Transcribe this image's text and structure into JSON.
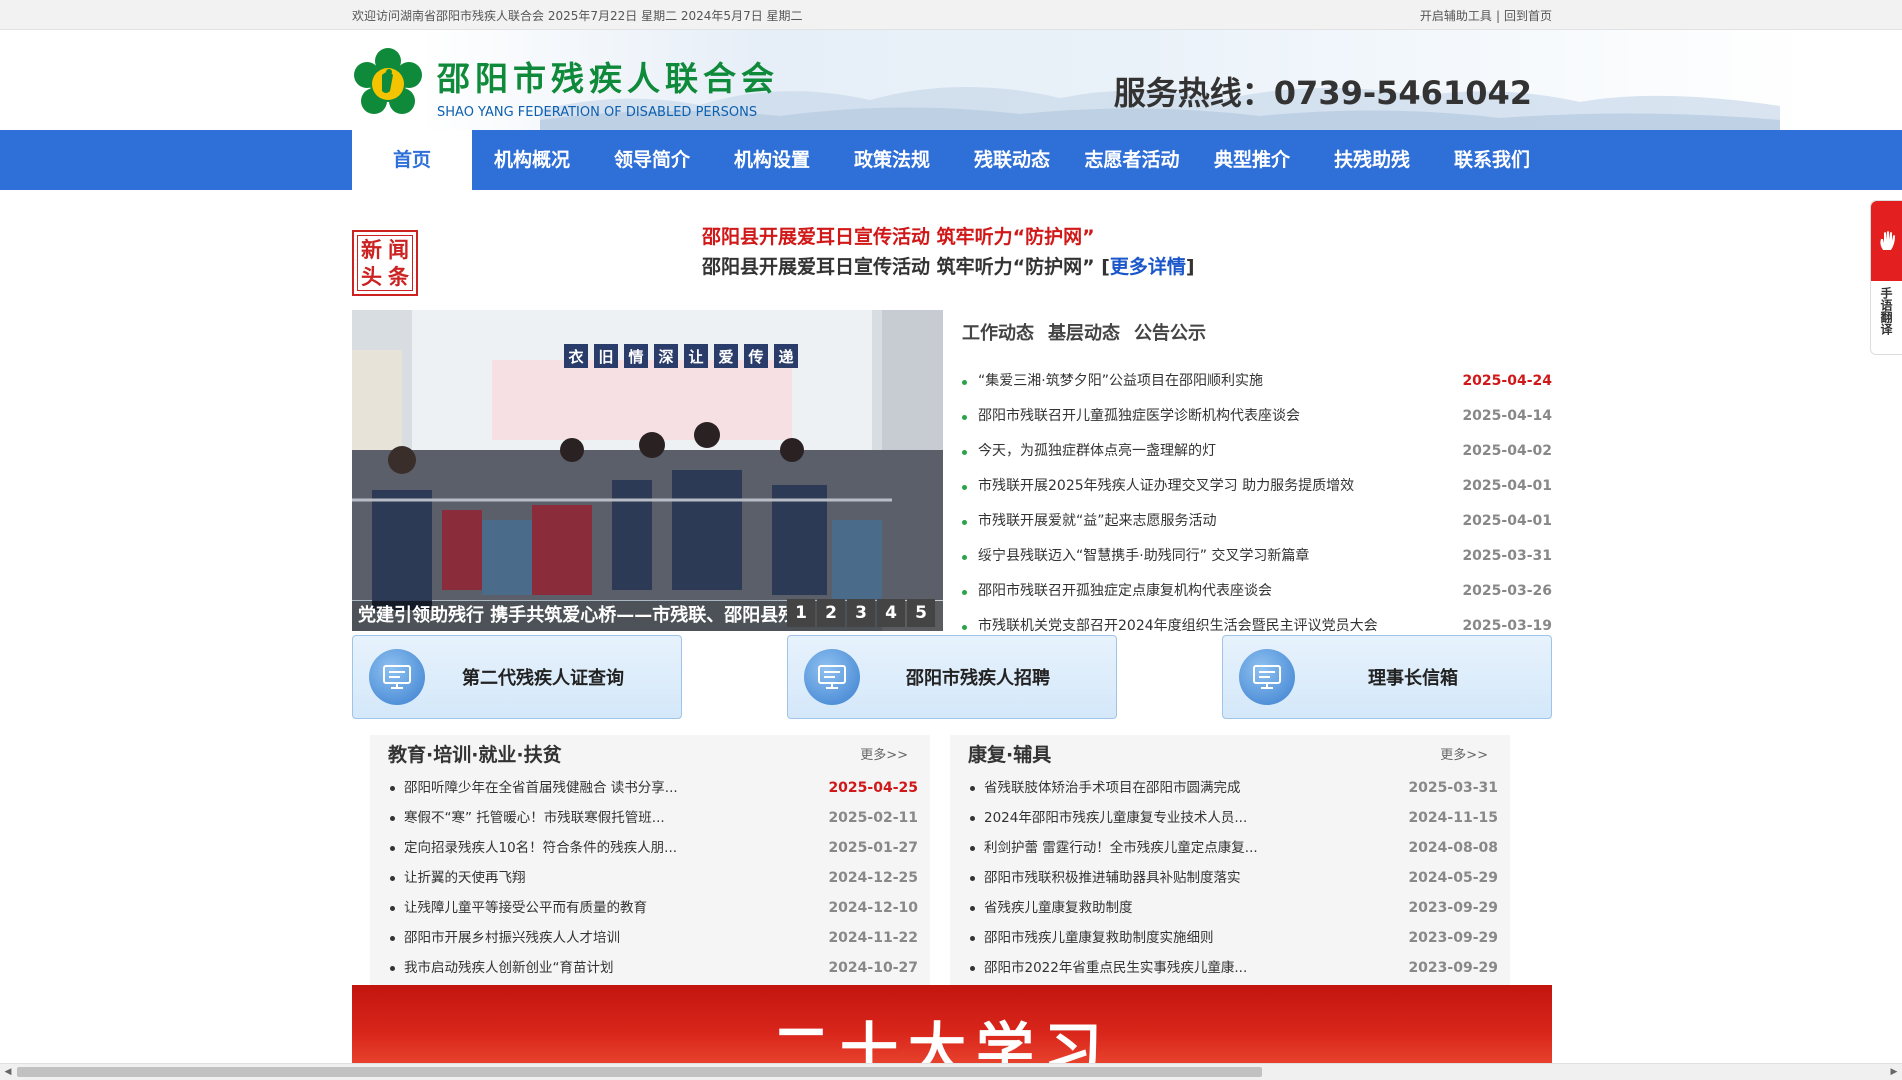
{
  "topbar": {
    "welcome": "欢迎访问湖南省邵阳市残疾人联合会 2025年7月22日 星期二 2024年5月7日 星期二",
    "assist_tool": "开启辅助工具",
    "separator": "|",
    "home_link": "回到首页"
  },
  "header": {
    "cn_name": "邵阳市残疾人联合会",
    "en_name": "SHAO YANG FEDERATION OF DISABLED PERSONS",
    "hotline": "服务热线：0739-5461042"
  },
  "nav": {
    "items": [
      "首页",
      "机构概况",
      "领导简介",
      "机构设置",
      "政策法规",
      "残联动态",
      "志愿者活动",
      "典型推介",
      "扶残助残",
      "联系我们"
    ],
    "active": "首页"
  },
  "headline": {
    "badge": [
      "新",
      "闻",
      "头",
      "条"
    ],
    "title": "邵阳县开展爱耳日宣传活动 筑牢听力“防护网”",
    "subtitle": "邵阳县开展爱耳日宣传活动 筑牢听力“防护网”",
    "bracket_open": "[",
    "more": "更多详情",
    "bracket_close": "]"
  },
  "slider": {
    "caption": "党建引领助残行 携手共筑爱心桥——市残联、邵阳县残联",
    "dots": [
      "1",
      "2",
      "3",
      "4",
      "5"
    ],
    "banner_text": [
      "衣",
      "旧",
      "情",
      "深",
      "让",
      "爱",
      "传",
      "递"
    ]
  },
  "news": {
    "tabs": [
      "工作动态",
      "基层动态",
      "公告公示"
    ],
    "items": [
      {
        "title": "“集爱三湘·筑梦夕阳”公益项目在邵阳顺利实施",
        "date": "2025-04-24",
        "hot": true
      },
      {
        "title": "邵阳市残联召开儿童孤独症医学诊断机构代表座谈会",
        "date": "2025-04-14",
        "hot": false
      },
      {
        "title": "今天，为孤独症群体点亮一盏理解的灯",
        "date": "2025-04-02",
        "hot": false
      },
      {
        "title": "市残联开展2025年残疾人证办理交叉学习 助力服务提质增效",
        "date": "2025-04-01",
        "hot": false
      },
      {
        "title": "市残联开展爱就“益”起来志愿服务活动",
        "date": "2025-04-01",
        "hot": false
      },
      {
        "title": "绥宁县残联迈入“智慧携手·助残同行” 交叉学习新篇章",
        "date": "2025-03-31",
        "hot": false
      },
      {
        "title": "邵阳市残联召开孤独症定点康复机构代表座谈会",
        "date": "2025-03-26",
        "hot": false
      },
      {
        "title": "市残联机关党支部召开2024年度组织生活会暨民主评议党员大会",
        "date": "2025-03-19",
        "hot": false
      }
    ]
  },
  "quick_links": [
    "第二代残疾人证查询",
    "邵阳市残疾人招聘",
    "理事长信箱"
  ],
  "col_left": {
    "title": "教育·培训·就业·扶贫",
    "more": "更多>>",
    "items": [
      {
        "title": "邵阳听障少年在全省首届残健融合 读书分享...",
        "date": "2025-04-25",
        "hot": true
      },
      {
        "title": "寒假不“寒” 托管暖心！市残联寒假托管班...",
        "date": "2025-02-11",
        "hot": false
      },
      {
        "title": "定向招录残疾人10名！符合条件的残疾人朋...",
        "date": "2025-01-27",
        "hot": false
      },
      {
        "title": "让折翼的天使再飞翔",
        "date": "2024-12-25",
        "hot": false
      },
      {
        "title": "让残障儿童平等接受公平而有质量的教育",
        "date": "2024-12-10",
        "hot": false
      },
      {
        "title": "邵阳市开展乡村振兴残疾人人才培训",
        "date": "2024-11-22",
        "hot": false
      },
      {
        "title": "我市启动残疾人创新创业“育苗计划",
        "date": "2024-10-27",
        "hot": false
      }
    ]
  },
  "col_right": {
    "title": "康复·辅具",
    "more": "更多>>",
    "items": [
      {
        "title": "省残联肢体矫治手术项目在邵阳市圆满完成",
        "date": "2025-03-31",
        "hot": false
      },
      {
        "title": "2024年邵阳市残疾儿童康复专业技术人员...",
        "date": "2024-11-15",
        "hot": false
      },
      {
        "title": "利剑护蕾 雷霆行动！全市残疾儿童定点康复...",
        "date": "2024-08-08",
        "hot": false
      },
      {
        "title": "邵阳市残联积极推进辅助器具补贴制度落实",
        "date": "2024-05-29",
        "hot": false
      },
      {
        "title": "省残疾儿童康复救助制度",
        "date": "2023-09-29",
        "hot": false
      },
      {
        "title": "邵阳市残疾儿童康复救助制度实施细则",
        "date": "2023-09-29",
        "hot": false
      },
      {
        "title": "邵阳市2022年省重点民生实事残疾儿童康...",
        "date": "2023-09-29",
        "hot": false
      }
    ]
  },
  "banner": {
    "text": "二十大学习"
  },
  "sign_widget": {
    "label": "手语翻译"
  },
  "colors": {
    "nav_blue": "#2f6fd8",
    "hot_red": "#d01818",
    "logo_green": "#0e8a3a"
  }
}
